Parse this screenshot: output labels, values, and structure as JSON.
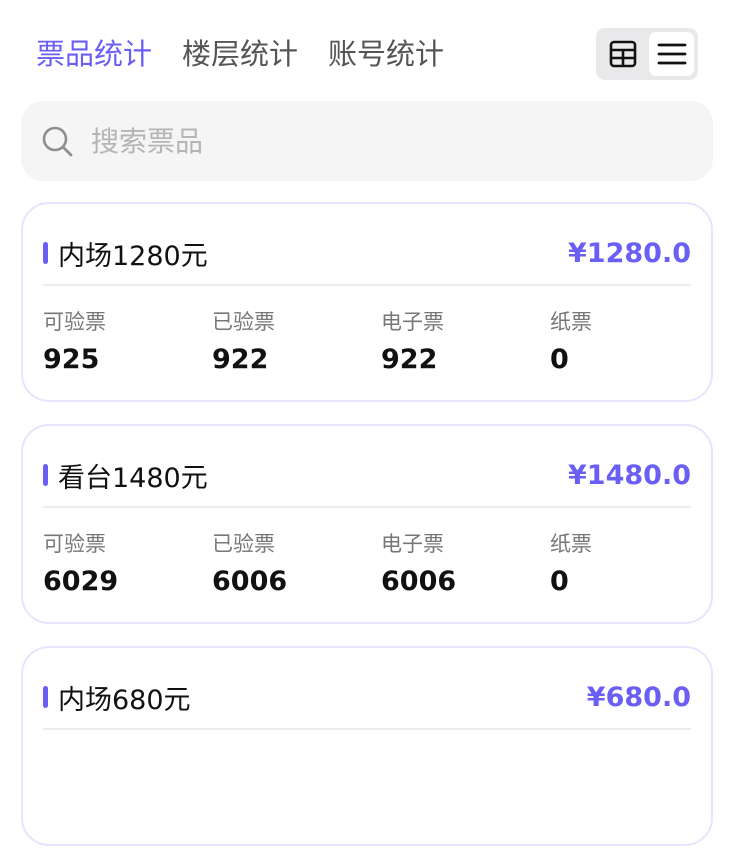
{
  "tabs": [
    {
      "label": "票品统计"
    },
    {
      "label": "楼层统计"
    },
    {
      "label": "账号统计"
    }
  ],
  "view_toggle": {
    "options": [
      "grid-view-icon",
      "list-view-icon"
    ],
    "selected": "list-view-icon"
  },
  "search": {
    "placeholder": "搜索票品",
    "value": ""
  },
  "colors": {
    "accent": "#6a5ff5",
    "card_border": "#e7e4fb",
    "search_bg": "#f5f5f6"
  },
  "cards": [
    {
      "title": "内场1280元",
      "price": "¥1280.0",
      "stats": [
        {
          "label": "可验票",
          "value": "925"
        },
        {
          "label": "已验票",
          "value": "922"
        },
        {
          "label": "电子票",
          "value": "922"
        },
        {
          "label": "纸票",
          "value": "0"
        }
      ]
    },
    {
      "title": "看台1480元",
      "price": "¥1480.0",
      "stats": [
        {
          "label": "可验票",
          "value": "6029"
        },
        {
          "label": "已验票",
          "value": "6006"
        },
        {
          "label": "电子票",
          "value": "6006"
        },
        {
          "label": "纸票",
          "value": "0"
        }
      ]
    },
    {
      "title": "内场680元",
      "price": "¥680.0",
      "stats": []
    }
  ]
}
